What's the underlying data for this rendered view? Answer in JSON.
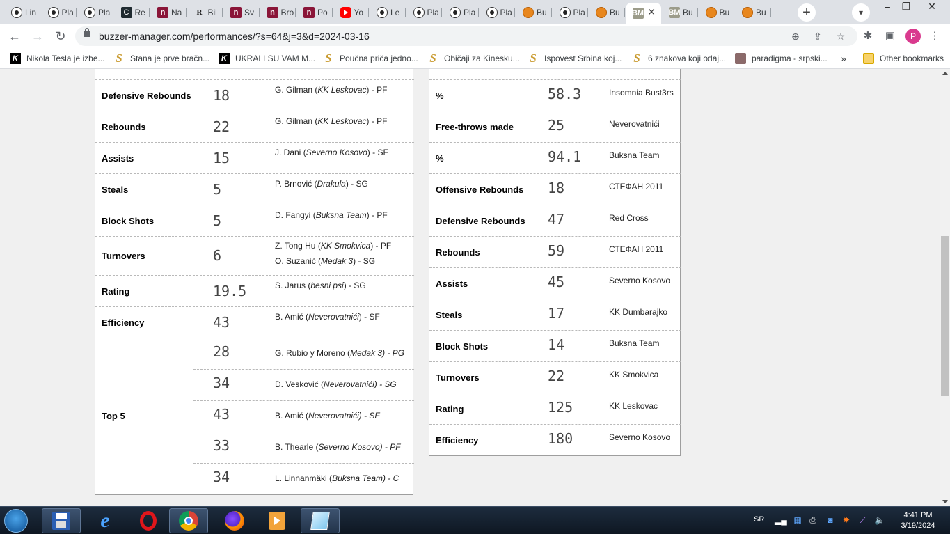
{
  "browser": {
    "tabs": [
      {
        "label": "Lin",
        "icon": "soccer-ball-icon"
      },
      {
        "label": "Pla",
        "icon": "soccer-ball-icon"
      },
      {
        "label": "Pla",
        "icon": "soccer-ball-icon"
      },
      {
        "label": "Re",
        "icon": "c-logo-icon"
      },
      {
        "label": "Na",
        "icon": "n-logo-icon"
      },
      {
        "label": "Bil",
        "icon": "r-logo-icon"
      },
      {
        "label": "Sv",
        "icon": "n-logo-icon"
      },
      {
        "label": "Bro",
        "icon": "n-logo-icon"
      },
      {
        "label": "Po",
        "icon": "n-logo-icon"
      },
      {
        "label": "Yo",
        "icon": "youtube-icon"
      },
      {
        "label": "Le",
        "icon": "soccer-ball-icon"
      },
      {
        "label": "Pla",
        "icon": "soccer-ball-icon"
      },
      {
        "label": "Pla",
        "icon": "soccer-ball-icon"
      },
      {
        "label": "Pla",
        "icon": "soccer-ball-icon"
      },
      {
        "label": "Bu",
        "icon": "basketball-icon"
      },
      {
        "label": "Pla",
        "icon": "soccer-ball-icon"
      },
      {
        "label": "Bu",
        "icon": "basketball-icon"
      },
      {
        "label": "",
        "icon": "bm-logo-icon",
        "active": true
      },
      {
        "label": "Bu",
        "icon": "bm-logo-icon"
      },
      {
        "label": "Bu",
        "icon": "basketball-icon"
      },
      {
        "label": "Bu",
        "icon": "basketball-icon"
      }
    ],
    "url": "buzzer-manager.com/performances/?s=64&j=3&d=2024-03-16",
    "profile_initial": "P",
    "bookmarks": [
      {
        "label": "Nikola Tesla je izbe...",
        "icon": "k-logo-icon"
      },
      {
        "label": "Stana je prve bračn...",
        "icon": "s-logo-icon"
      },
      {
        "label": "UKRALI SU VAM M...",
        "icon": "k-logo-icon"
      },
      {
        "label": "Poučna priča jedno...",
        "icon": "s-logo-icon"
      },
      {
        "label": "Običaji za Kinesku...",
        "icon": "s-logo-icon"
      },
      {
        "label": "Ispovest Srbina koj...",
        "icon": "s-logo-icon"
      },
      {
        "label": "6 znakova koji odaj...",
        "icon": "s-logo-icon"
      },
      {
        "label": "paradigma - srpski...",
        "icon": "paradigma-icon"
      }
    ],
    "bookmarks_more": "»",
    "other_bookmarks": "Other bookmarks"
  },
  "players_records": [
    {
      "label": "Defensive Rebounds",
      "value": "18",
      "holders": [
        {
          "name": "G. Gilman",
          "team": "KK Leskovac",
          "pos": "PF"
        }
      ]
    },
    {
      "label": "Rebounds",
      "value": "22",
      "holders": [
        {
          "name": "G. Gilman",
          "team": "KK Leskovac",
          "pos": "PF"
        }
      ]
    },
    {
      "label": "Assists",
      "value": "15",
      "holders": [
        {
          "name": "J. Dani",
          "team": "Severno Kosovo",
          "pos": "SF"
        }
      ]
    },
    {
      "label": "Steals",
      "value": "5",
      "holders": [
        {
          "name": "P. Brnović",
          "team": "Drakula",
          "pos": "SG"
        }
      ]
    },
    {
      "label": "Block Shots",
      "value": "5",
      "holders": [
        {
          "name": "D. Fangyi",
          "team": "Buksna Team",
          "pos": "PF"
        }
      ]
    },
    {
      "label": "Turnovers",
      "value": "6",
      "holders": [
        {
          "name": "Z. Tong Hu",
          "team": "KK Smokvica",
          "pos": "PF"
        },
        {
          "name": "O. Suzanić",
          "team": "Medak 3",
          "pos": "SG"
        }
      ]
    },
    {
      "label": "Rating",
      "value": "19.5",
      "holders": [
        {
          "name": "S. Jarus",
          "team": "besni psi",
          "pos": "SG"
        }
      ]
    },
    {
      "label": "Efficiency",
      "value": "43",
      "holders": [
        {
          "name": "B. Amić",
          "team": "Neverovatnići",
          "pos": "SF"
        }
      ]
    }
  ],
  "top5": {
    "label": "Top 5",
    "entries": [
      {
        "value": "28",
        "name": "G. Rubio y Moreno",
        "team": "Medak 3",
        "pos": "PG"
      },
      {
        "value": "34",
        "name": "D. Vesković",
        "team": "Neverovatnići",
        "pos": "SG"
      },
      {
        "value": "43",
        "name": "B. Amić",
        "team": "Neverovatnići",
        "pos": "SF"
      },
      {
        "value": "33",
        "name": "B. Thearle",
        "team": "Severno Kosovo",
        "pos": "PF"
      },
      {
        "value": "34",
        "name": "L. Linnanmäki",
        "team": "Buksna Team",
        "pos": "C"
      }
    ]
  },
  "team_records": [
    {
      "label": "%",
      "value": "58.3",
      "team": "Insomnia Bust3rs"
    },
    {
      "label": "Free-throws made",
      "value": "25",
      "team": "Neverovatnići"
    },
    {
      "label": "%",
      "value": "94.1",
      "team": "Buksna Team"
    },
    {
      "label": "Offensive Rebounds",
      "value": "18",
      "team": "СТЕФАН 2011"
    },
    {
      "label": "Defensive Rebounds",
      "value": "47",
      "team": "Red Cross"
    },
    {
      "label": "Rebounds",
      "value": "59",
      "team": "СТЕФАН 2011"
    },
    {
      "label": "Assists",
      "value": "45",
      "team": "Severno Kosovo"
    },
    {
      "label": "Steals",
      "value": "17",
      "team": "KK Dumbarajko"
    },
    {
      "label": "Block Shots",
      "value": "14",
      "team": "Buksna Team"
    },
    {
      "label": "Turnovers",
      "value": "22",
      "team": "KK Smokvica"
    },
    {
      "label": "Rating",
      "value": "125",
      "team": "KK Leskovac"
    },
    {
      "label": "Efficiency",
      "value": "180",
      "team": "Severno Kosovo"
    }
  ],
  "taskbar": {
    "language": "SR",
    "time": "4:41 PM",
    "date": "3/19/2024"
  }
}
